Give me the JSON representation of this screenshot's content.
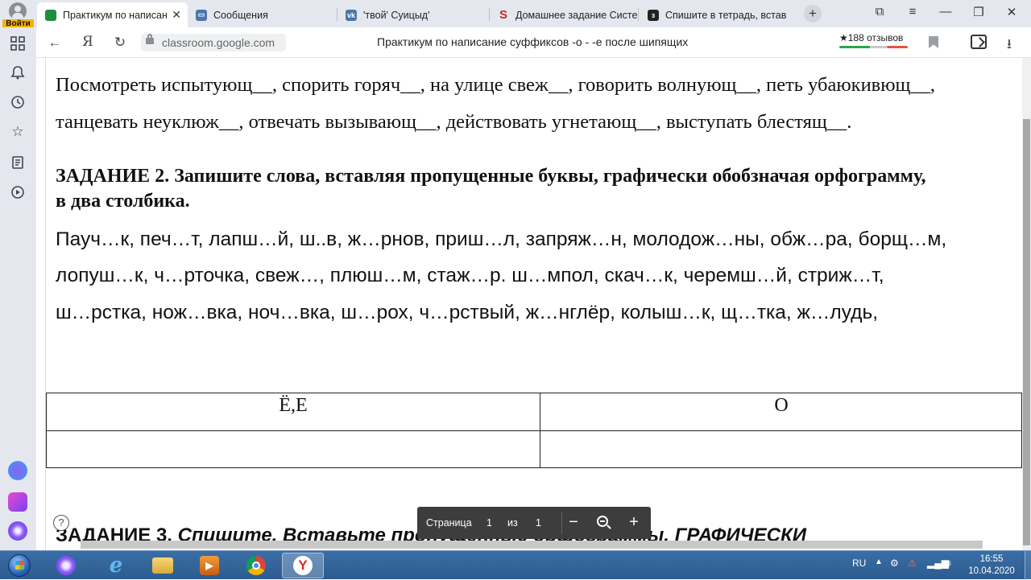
{
  "browser": {
    "login_label": "Войти",
    "tabs": [
      {
        "title": "Практикум по написан",
        "favicon": "google-classroom-icon",
        "active": true
      },
      {
        "title": "Сообщения",
        "favicon": "messages-icon",
        "active": false
      },
      {
        "title": "'твой' Суицыд'",
        "favicon": "vk-icon",
        "active": false
      },
      {
        "title": "Домашнее задание Систе",
        "favicon": "s-icon",
        "active": false
      },
      {
        "title": "Спишите в тетрадь, встав",
        "favicon": "z-icon",
        "active": false
      }
    ],
    "yandex_letter": "Я",
    "url": "classroom.google.com",
    "page_title": "Практикум по написание суффиксов -о - -е после шипящих",
    "reviews": "★188 отзывов"
  },
  "document": {
    "line1": "Посмотреть испытующ__, спорить горяч__, на улице свеж__, говорить волнующ__, петь убаюкивющ__,",
    "line2": "танцевать неуклюж__, отвечать вызывающ__, действовать угнетающ__, выступать блестящ__.",
    "task2_title_line1": "ЗАДАНИЕ 2. Запишите слова, вставляя пропущенные буквы, графически обобзначая орфограмму,",
    "task2_title_line2": "в два столбика.",
    "words_line1": "Пауч…к, печ…т, лапш…й, ш..в, ж…рнов, приш…л, запряж…н, молодож…ны, обж…ра, борщ…м,",
    "words_line2": "лопуш…к, ч…рточка, свеж…, плюш…м, стаж…р. ш…мпол, скач…к, черемш…й, стриж…т,",
    "words_line3": "ш…рстка, нож…вка, ноч…вка, ш…рох, ч…рствый, ж…нглёр, колыш…к, щ…тка, ж…лудь,",
    "table": {
      "col1": "Ё,Е",
      "col2": "О"
    },
    "task3_prefix": "ЗАДАНИЕ 3.",
    "task3_text": "Спишите. Вставьте пропущенные орфограммы. ГРАФИЧЕСКИ"
  },
  "pdf_toolbar": {
    "page_label": "Страница",
    "current_page": "1",
    "of_label": "из",
    "total_pages": "1"
  },
  "taskbar": {
    "language": "RU",
    "time": "16:55",
    "date": "10.04.2020"
  }
}
